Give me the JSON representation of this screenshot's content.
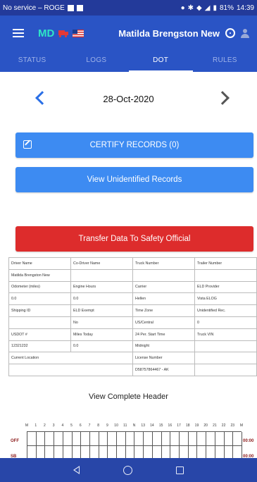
{
  "status_bar": {
    "carrier": "No service – ROGE",
    "battery": "81%",
    "time": "14:39"
  },
  "app_header": {
    "md_label": "MD",
    "driver_name": "Matilda Brengston New",
    "icons": [
      "menu-icon",
      "truck-icon",
      "us-flag-icon",
      "steering-wheel-icon",
      "person-icon"
    ]
  },
  "tabs": [
    {
      "label": "STATUS",
      "active": false
    },
    {
      "label": "LOGS",
      "active": false
    },
    {
      "label": "DOT",
      "active": true
    },
    {
      "label": "RULES",
      "active": false
    }
  ],
  "date_nav": {
    "date": "28-Oct-2020"
  },
  "buttons": {
    "certify": "CERTIFY RECORDS (0)",
    "unidentified": "View Unidentified Records",
    "transfer": "Transfer Data To Safety Official"
  },
  "header_table": {
    "rows": [
      [
        "Driver Name",
        "Co-Driver Name",
        "Truck Number",
        "Trailer Number"
      ],
      [
        "Matilda Brengston New",
        "",
        "",
        ""
      ],
      [
        "Odometer (miles)",
        "Engine Hours",
        "Carrier",
        "ELD Provider"
      ],
      [
        "0.0",
        "0.0",
        "Hellen",
        "Vista ELOG"
      ],
      [
        "Shipping ID",
        "ELD Exempt",
        "Time Zone",
        "Unidentified Rec."
      ],
      [
        "",
        "No",
        "US/Central",
        "0"
      ],
      [
        "USDOT #",
        "Miles Today",
        "24 Per. Start Time",
        "Truck VIN"
      ],
      [
        "12321232",
        "0.0",
        "Midnight",
        ""
      ],
      [
        "Current Location",
        "",
        "License Number",
        ""
      ],
      [
        "",
        "",
        "D58757864467 - AK",
        ""
      ]
    ]
  },
  "complete_header": "View Complete Header",
  "log_grid": {
    "hours": [
      "M",
      "1",
      "2",
      "3",
      "4",
      "5",
      "6",
      "7",
      "8",
      "9",
      "10",
      "11",
      "N",
      "13",
      "14",
      "15",
      "16",
      "17",
      "18",
      "19",
      "20",
      "21",
      "22",
      "23",
      "M"
    ],
    "row_labels": [
      "OFF",
      "SB"
    ],
    "totals": [
      "00:00",
      "00:00"
    ]
  },
  "colors": {
    "brand_blue": "#2a54c5",
    "button_blue": "#3d8bf2",
    "danger_red": "#dd2c2c",
    "md_teal": "#2ee6c7"
  }
}
